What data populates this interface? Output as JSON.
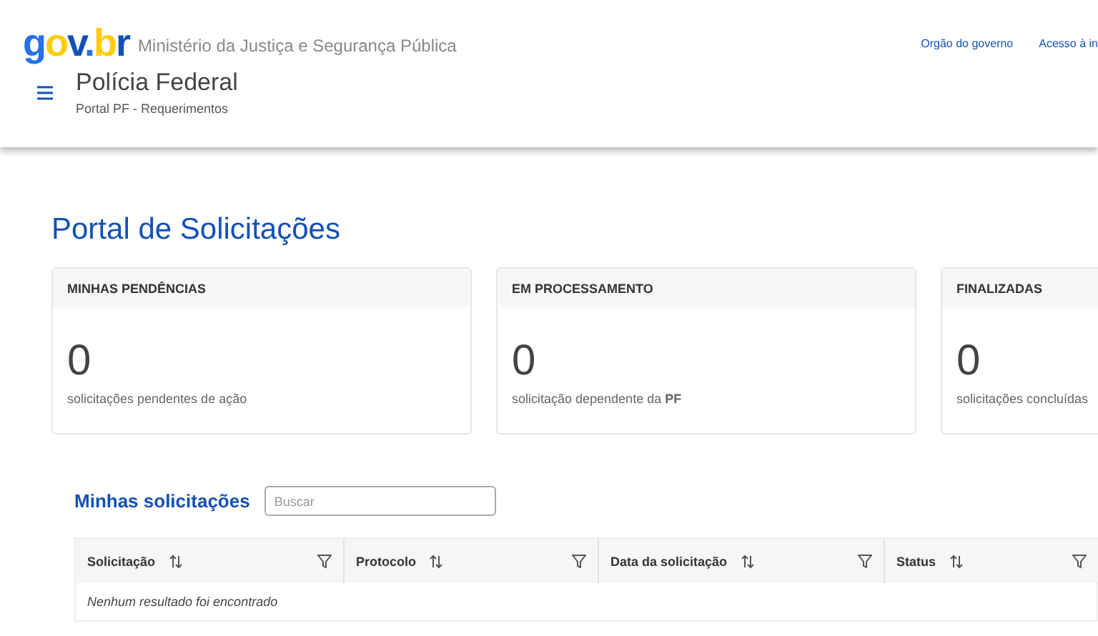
{
  "header": {
    "logo": "gov.br",
    "ministry": "Ministério da Justiça e Segurança Pública",
    "links": [
      "Orgão do governo",
      "Acesso à in"
    ],
    "title": "Polícia Federal",
    "subtitle": "Portal PF - Requerimentos"
  },
  "page_title": "Portal de Solicitações",
  "cards": [
    {
      "title": "MINHAS PENDÊNCIAS",
      "count": "0",
      "caption": "solicitações pendentes de ação"
    },
    {
      "title": "EM PROCESSAMENTO",
      "count": "0",
      "caption": "solicitação dependente da **PF**"
    },
    {
      "title": "FINALIZADAS",
      "count": "0",
      "caption": "solicitações concluídas"
    }
  ],
  "requests": {
    "title": "Minhas solicitações",
    "search": {
      "placeholder": "Buscar"
    },
    "columns": [
      "Solicitação",
      "Protocolo",
      "Data da solicitação",
      "Status"
    ],
    "empty": "Nenhum resultado foi encontrado"
  }
}
